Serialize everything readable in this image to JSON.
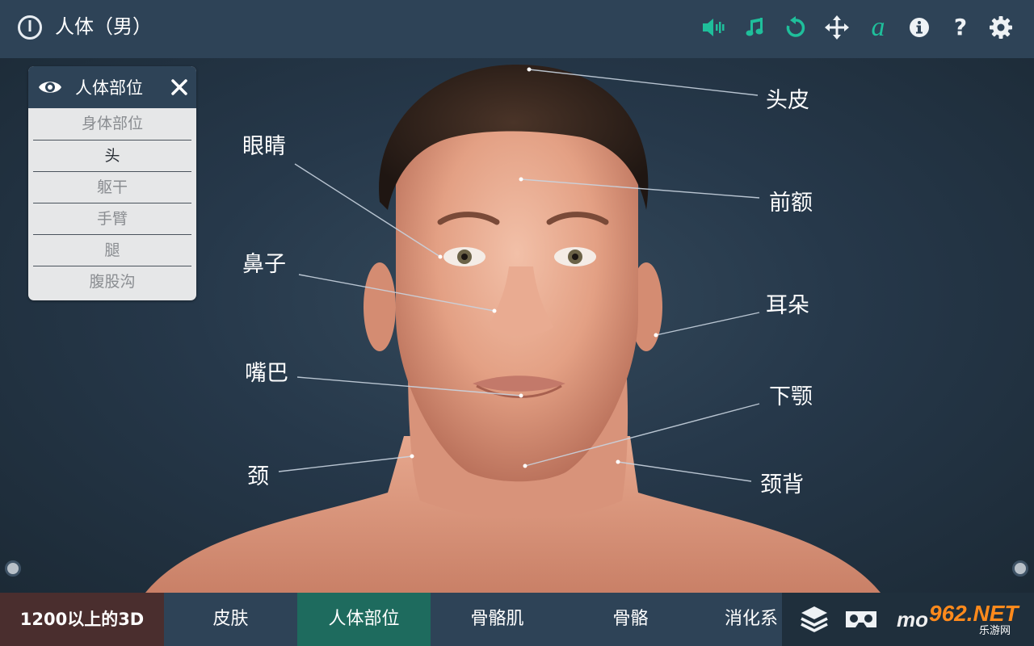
{
  "header": {
    "title": "人体（男）",
    "icons": [
      "power-icon",
      "speaker-icon",
      "music-note-icon",
      "rotate-icon",
      "move-icon",
      "font-icon",
      "info-icon",
      "help-icon",
      "gear-icon"
    ],
    "accent": "#1fbf9b"
  },
  "panel": {
    "title": "人体部位",
    "items": [
      {
        "label": "身体部位"
      },
      {
        "label": "头"
      },
      {
        "label": "躯干"
      },
      {
        "label": "手臂"
      },
      {
        "label": "腿"
      },
      {
        "label": "腹股沟"
      }
    ],
    "selected": "头"
  },
  "labels": {
    "scalp": "头皮",
    "eyes": "眼睛",
    "forehead": "前额",
    "nose": "鼻子",
    "ear": "耳朵",
    "mouth": "嘴巴",
    "jaw": "下颚",
    "neck": "颈",
    "back_of_neck": "颈背"
  },
  "footer": {
    "brand": "1200以上的3D",
    "tabs": [
      {
        "label": "皮肤"
      },
      {
        "label": "人体部位"
      },
      {
        "label": "骨骼肌"
      },
      {
        "label": "骨骼"
      },
      {
        "label": "消化系"
      }
    ],
    "active_tab": "人体部位",
    "watermark_left": "mo",
    "watermark_main": "962.NET",
    "watermark_sub": "乐游网"
  }
}
